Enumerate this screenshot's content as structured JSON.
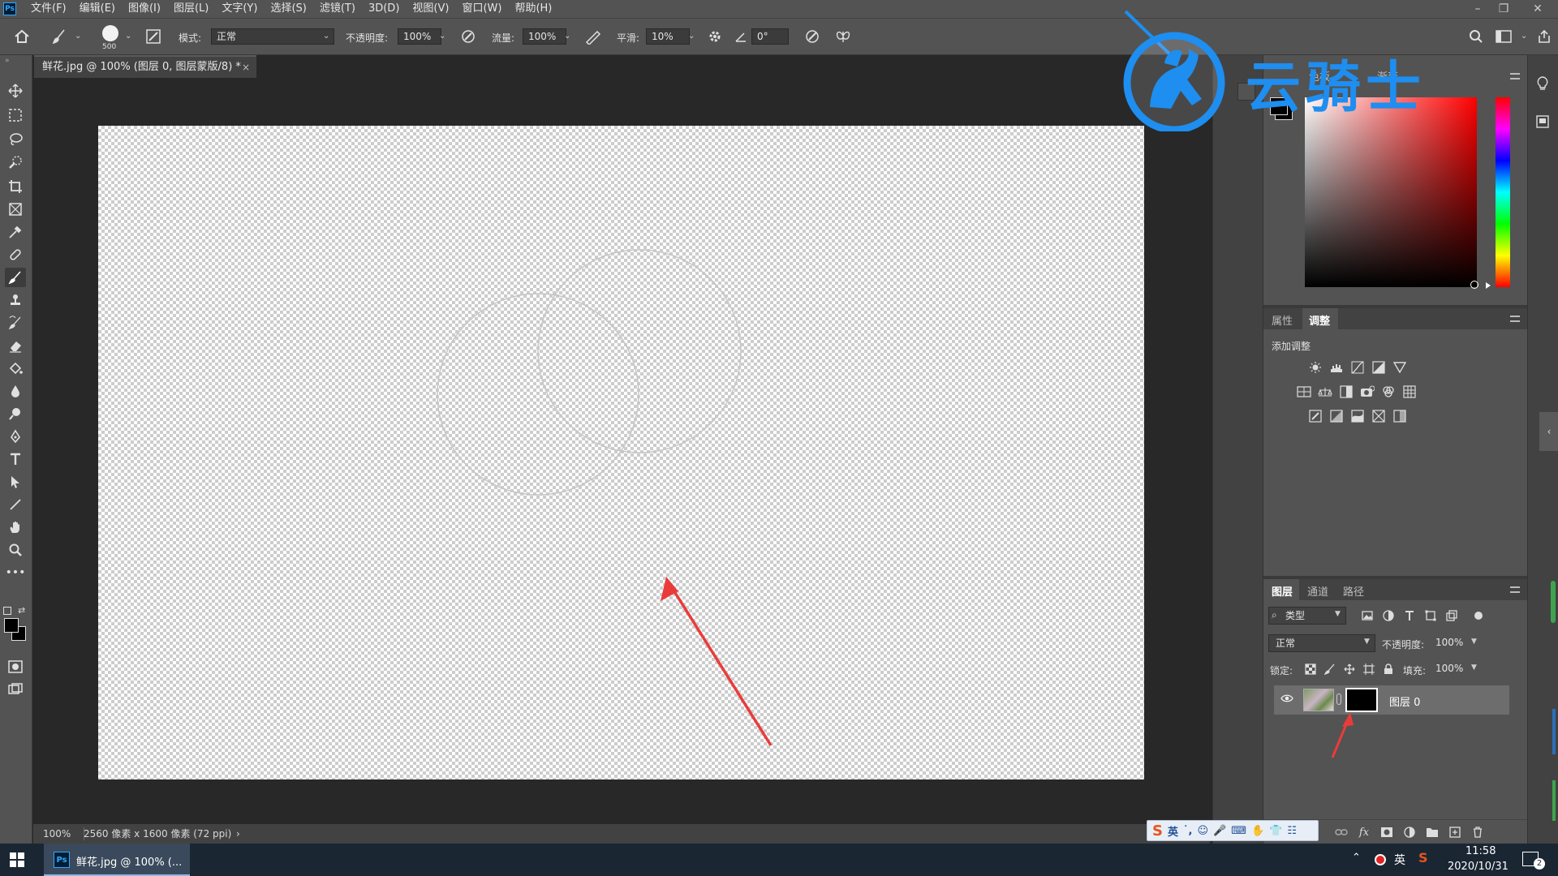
{
  "menubar": {
    "items": [
      "文件(F)",
      "编辑(E)",
      "图像(I)",
      "图层(L)",
      "文字(Y)",
      "选择(S)",
      "滤镜(T)",
      "3D(D)",
      "视图(V)",
      "窗口(W)",
      "帮助(H)"
    ],
    "window_controls": [
      "–",
      "❐",
      "✕"
    ]
  },
  "options": {
    "brush_size": "500",
    "mode_label": "模式:",
    "mode_value": "正常",
    "opacity_label": "不透明度:",
    "opacity_value": "100%",
    "flow_label": "流量:",
    "flow_value": "100%",
    "smooth_label": "平滑:",
    "smooth_value": "10%",
    "angle_value": "0°"
  },
  "document": {
    "tab_title": "鲜花.jpg @ 100% (图层 0, 图层蒙版/8) *",
    "tab_close": "×"
  },
  "status": {
    "zoom": "100%",
    "info": "2560 像素 x 1600 像素 (72 ppi)",
    "arrow": "›"
  },
  "adjustments_panel": {
    "tabs": [
      "属性",
      "调整"
    ],
    "active_tab": "调整",
    "heading": "添加调整"
  },
  "color_panel": {
    "tabs": [
      "色板",
      "渐变"
    ]
  },
  "layers_panel": {
    "tabs": [
      "图层",
      "通道",
      "路径"
    ],
    "active_tab": "图层",
    "filter_label": "类型",
    "blend_mode": "正常",
    "opacity_label": "不透明度:",
    "opacity_value": "100%",
    "lock_label": "锁定:",
    "fill_label": "填充:",
    "fill_value": "100%",
    "layers": [
      {
        "name": "图层 0",
        "visible": true,
        "has_mask": true
      }
    ]
  },
  "ime": {
    "items": [
      "S",
      "英",
      "˙,",
      "☺",
      "🎤",
      "⌨",
      "✋",
      "👕",
      "☷"
    ]
  },
  "taskbar": {
    "app_label": "鲜花.jpg @ 100% (...",
    "tray_lang": "英",
    "time": "11:58",
    "date": "2020/10/31",
    "notification_count": "2"
  },
  "watermark": {
    "text": "云骑士"
  },
  "colors": {
    "ps_blue": "#31a8ff",
    "panel_bg": "#535353",
    "dark_bg": "#282828",
    "annotation_red": "#ea3b3b",
    "watermark_blue": "#1e8ef0"
  }
}
